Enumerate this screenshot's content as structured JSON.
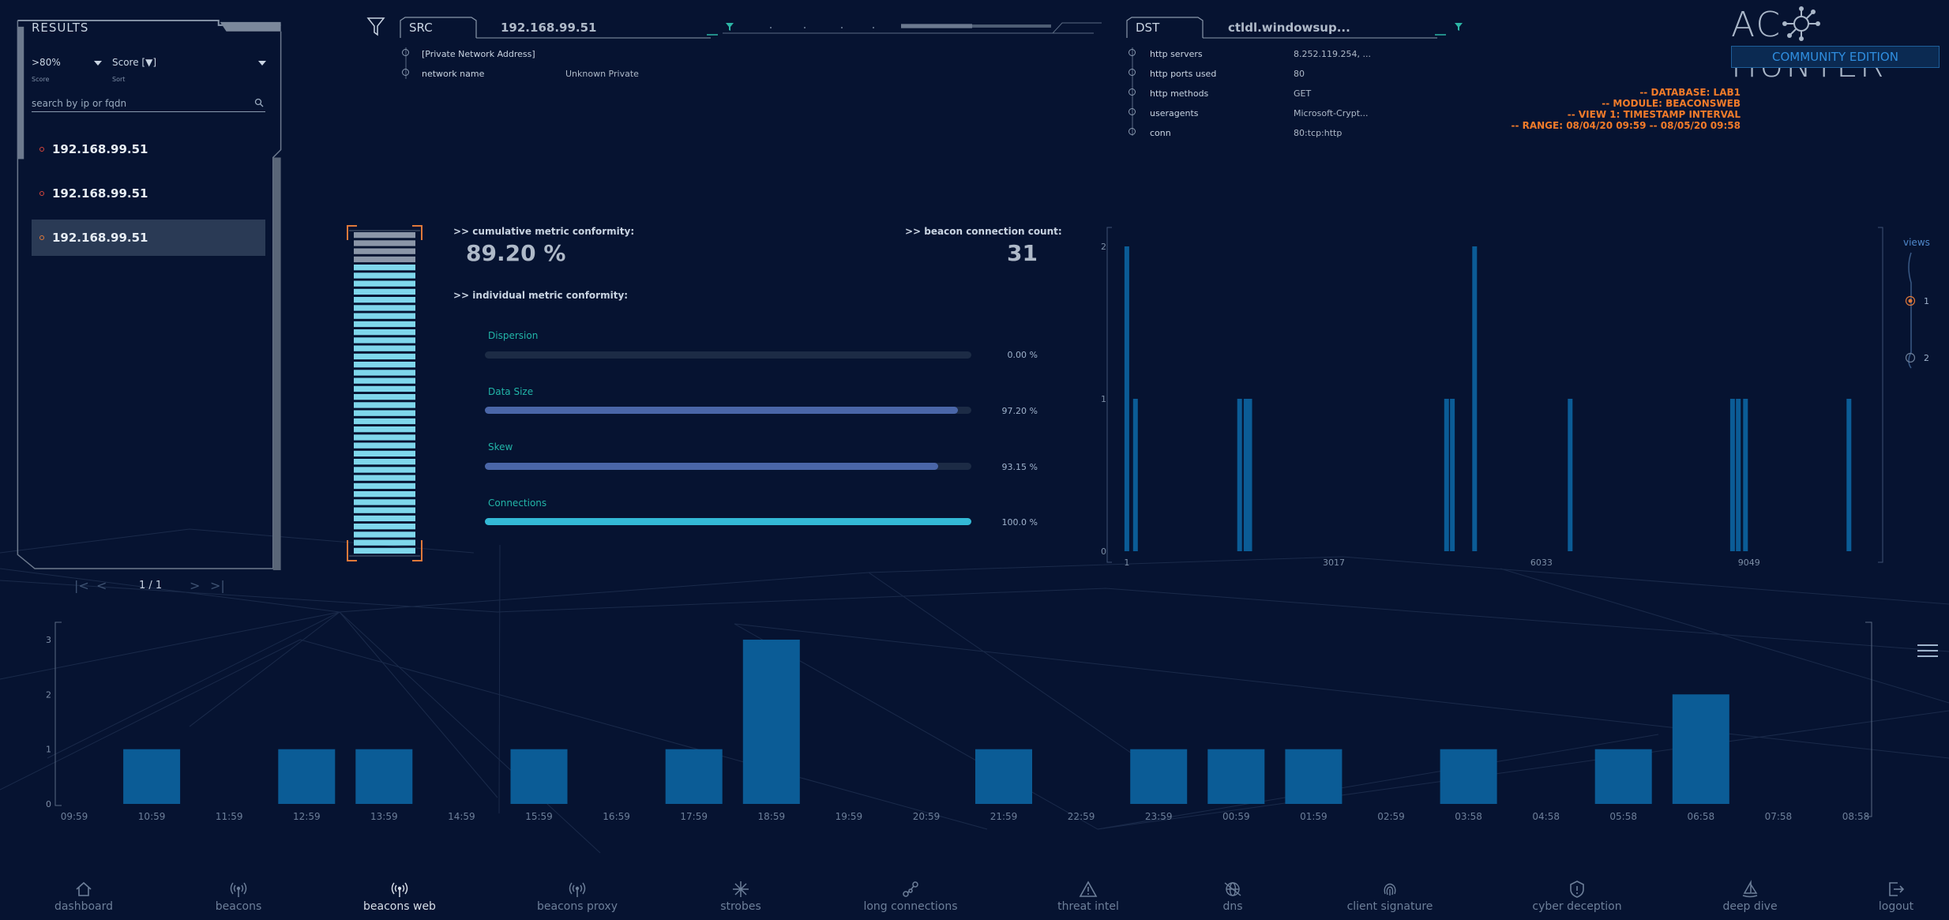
{
  "results": {
    "title": "RESULTS",
    "threshold_value": ">80%",
    "threshold_caption": "Score",
    "sort_value": "Score [▼]",
    "sort_caption": "Sort",
    "search_placeholder": "search by ip or fqdn",
    "items": [
      {
        "ip": "192.168.99.51",
        "selected": false
      },
      {
        "ip": "192.168.99.51",
        "selected": false
      },
      {
        "ip": "192.168.99.51",
        "selected": true
      }
    ],
    "pager": {
      "label": "1 / 1",
      "first": "|<",
      "prev": "<",
      "next": ">",
      "last": ">|"
    }
  },
  "src": {
    "label": "SRC",
    "value": "192.168.99.51",
    "fields": [
      {
        "key": "[Private Network Address]",
        "value": ""
      },
      {
        "key": "network name",
        "value": "Unknown Private"
      }
    ]
  },
  "dst": {
    "label": "DST",
    "value": "ctldl.windowsup...",
    "fields": [
      {
        "key": "http servers",
        "value": "8.252.119.254, ..."
      },
      {
        "key": "http ports used",
        "value": "80"
      },
      {
        "key": "http methods",
        "value": "GET"
      },
      {
        "key": "useragents",
        "value": "Microsoft-Crypt..."
      },
      {
        "key": "conn",
        "value": "80:tcp:http"
      }
    ]
  },
  "brand": {
    "name_left": "AC",
    "name_right": "HUNTER",
    "edition": "COMMUNITY EDITION"
  },
  "db_info": [
    "-- DATABASE: LAB1",
    "-- MODULE: BEACONSWEB",
    "-- VIEW 1: TIMESTAMP INTERVAL",
    "-- RANGE: 08/04/20 09:59 -- 08/05/20 09:58"
  ],
  "metrics": {
    "cumulative_label": ">> cumulative metric conformity:",
    "cumulative_value": "89.20 %",
    "cumulative_fraction": 0.892,
    "count_label": ">> beacon connection count:",
    "count_value": "31",
    "individual_label": ">> individual metric conformity:",
    "bars": [
      {
        "label": "Dispersion",
        "percent_text": "0.00 %",
        "fraction": 0.0,
        "color": "#4a66a8"
      },
      {
        "label": "Data Size",
        "percent_text": "97.20 %",
        "fraction": 0.972,
        "color": "#4a66a8"
      },
      {
        "label": "Skew",
        "percent_text": "93.15 %",
        "fraction": 0.9315,
        "color": "#4a66a8"
      },
      {
        "label": "Connections",
        "percent_text": "100.0 %",
        "fraction": 1.0,
        "color": "#33b9d6"
      }
    ]
  },
  "views": {
    "label": "views",
    "options": [
      "1",
      "2"
    ],
    "selected": "1"
  },
  "chart_data": [
    {
      "type": "bar",
      "x": [
        1,
        13,
        158,
        167,
        172,
        446,
        454,
        485,
        618,
        844,
        852,
        862,
        1006
      ],
      "values": [
        2,
        1,
        1,
        1,
        1,
        1,
        1,
        2,
        1,
        1,
        1,
        1,
        1
      ],
      "xticks": [
        "1",
        "3017",
        "6033",
        "9049"
      ],
      "xlim": [
        0,
        1020
      ],
      "yticks": [
        "0",
        "1",
        "2"
      ],
      "ylim": [
        0,
        2
      ],
      "color": "#0b5c96"
    },
    {
      "type": "bar",
      "categories": [
        "09:59",
        "10:59",
        "11:59",
        "12:59",
        "13:59",
        "14:59",
        "15:59",
        "16:59",
        "17:59",
        "18:59",
        "19:59",
        "20:59",
        "21:59",
        "22:59",
        "23:59",
        "00:59",
        "01:59",
        "02:59",
        "03:58",
        "04:58",
        "05:58",
        "06:58",
        "07:58",
        "08:58"
      ],
      "values": [
        0,
        1,
        0,
        1,
        1,
        0,
        1,
        0,
        1,
        3,
        0,
        0,
        1,
        0,
        1,
        1,
        1,
        0,
        1,
        0,
        1,
        2,
        0,
        0
      ],
      "yticks": [
        "0",
        "1",
        "2",
        "3"
      ],
      "ylim": [
        0,
        3
      ],
      "color": "#0b5c96"
    }
  ],
  "nav": [
    {
      "label": "dashboard",
      "icon": "home-icon",
      "active": false
    },
    {
      "label": "beacons",
      "icon": "antenna-icon",
      "active": false
    },
    {
      "label": "beacons web",
      "icon": "antenna-icon",
      "active": true
    },
    {
      "label": "beacons proxy",
      "icon": "antenna-icon",
      "active": false
    },
    {
      "label": "strobes",
      "icon": "burst-icon",
      "active": false
    },
    {
      "label": "long connections",
      "icon": "nodes-icon",
      "active": false
    },
    {
      "label": "threat intel",
      "icon": "warning-icon",
      "active": false
    },
    {
      "label": "dns",
      "icon": "globe-icon",
      "active": false
    },
    {
      "label": "client signature",
      "icon": "fingerprint-icon",
      "active": false
    },
    {
      "label": "cyber deception",
      "icon": "shield-icon",
      "active": false
    },
    {
      "label": "deep dive",
      "icon": "sail-icon",
      "active": false
    },
    {
      "label": "logout",
      "icon": "logout-icon",
      "active": false
    }
  ]
}
